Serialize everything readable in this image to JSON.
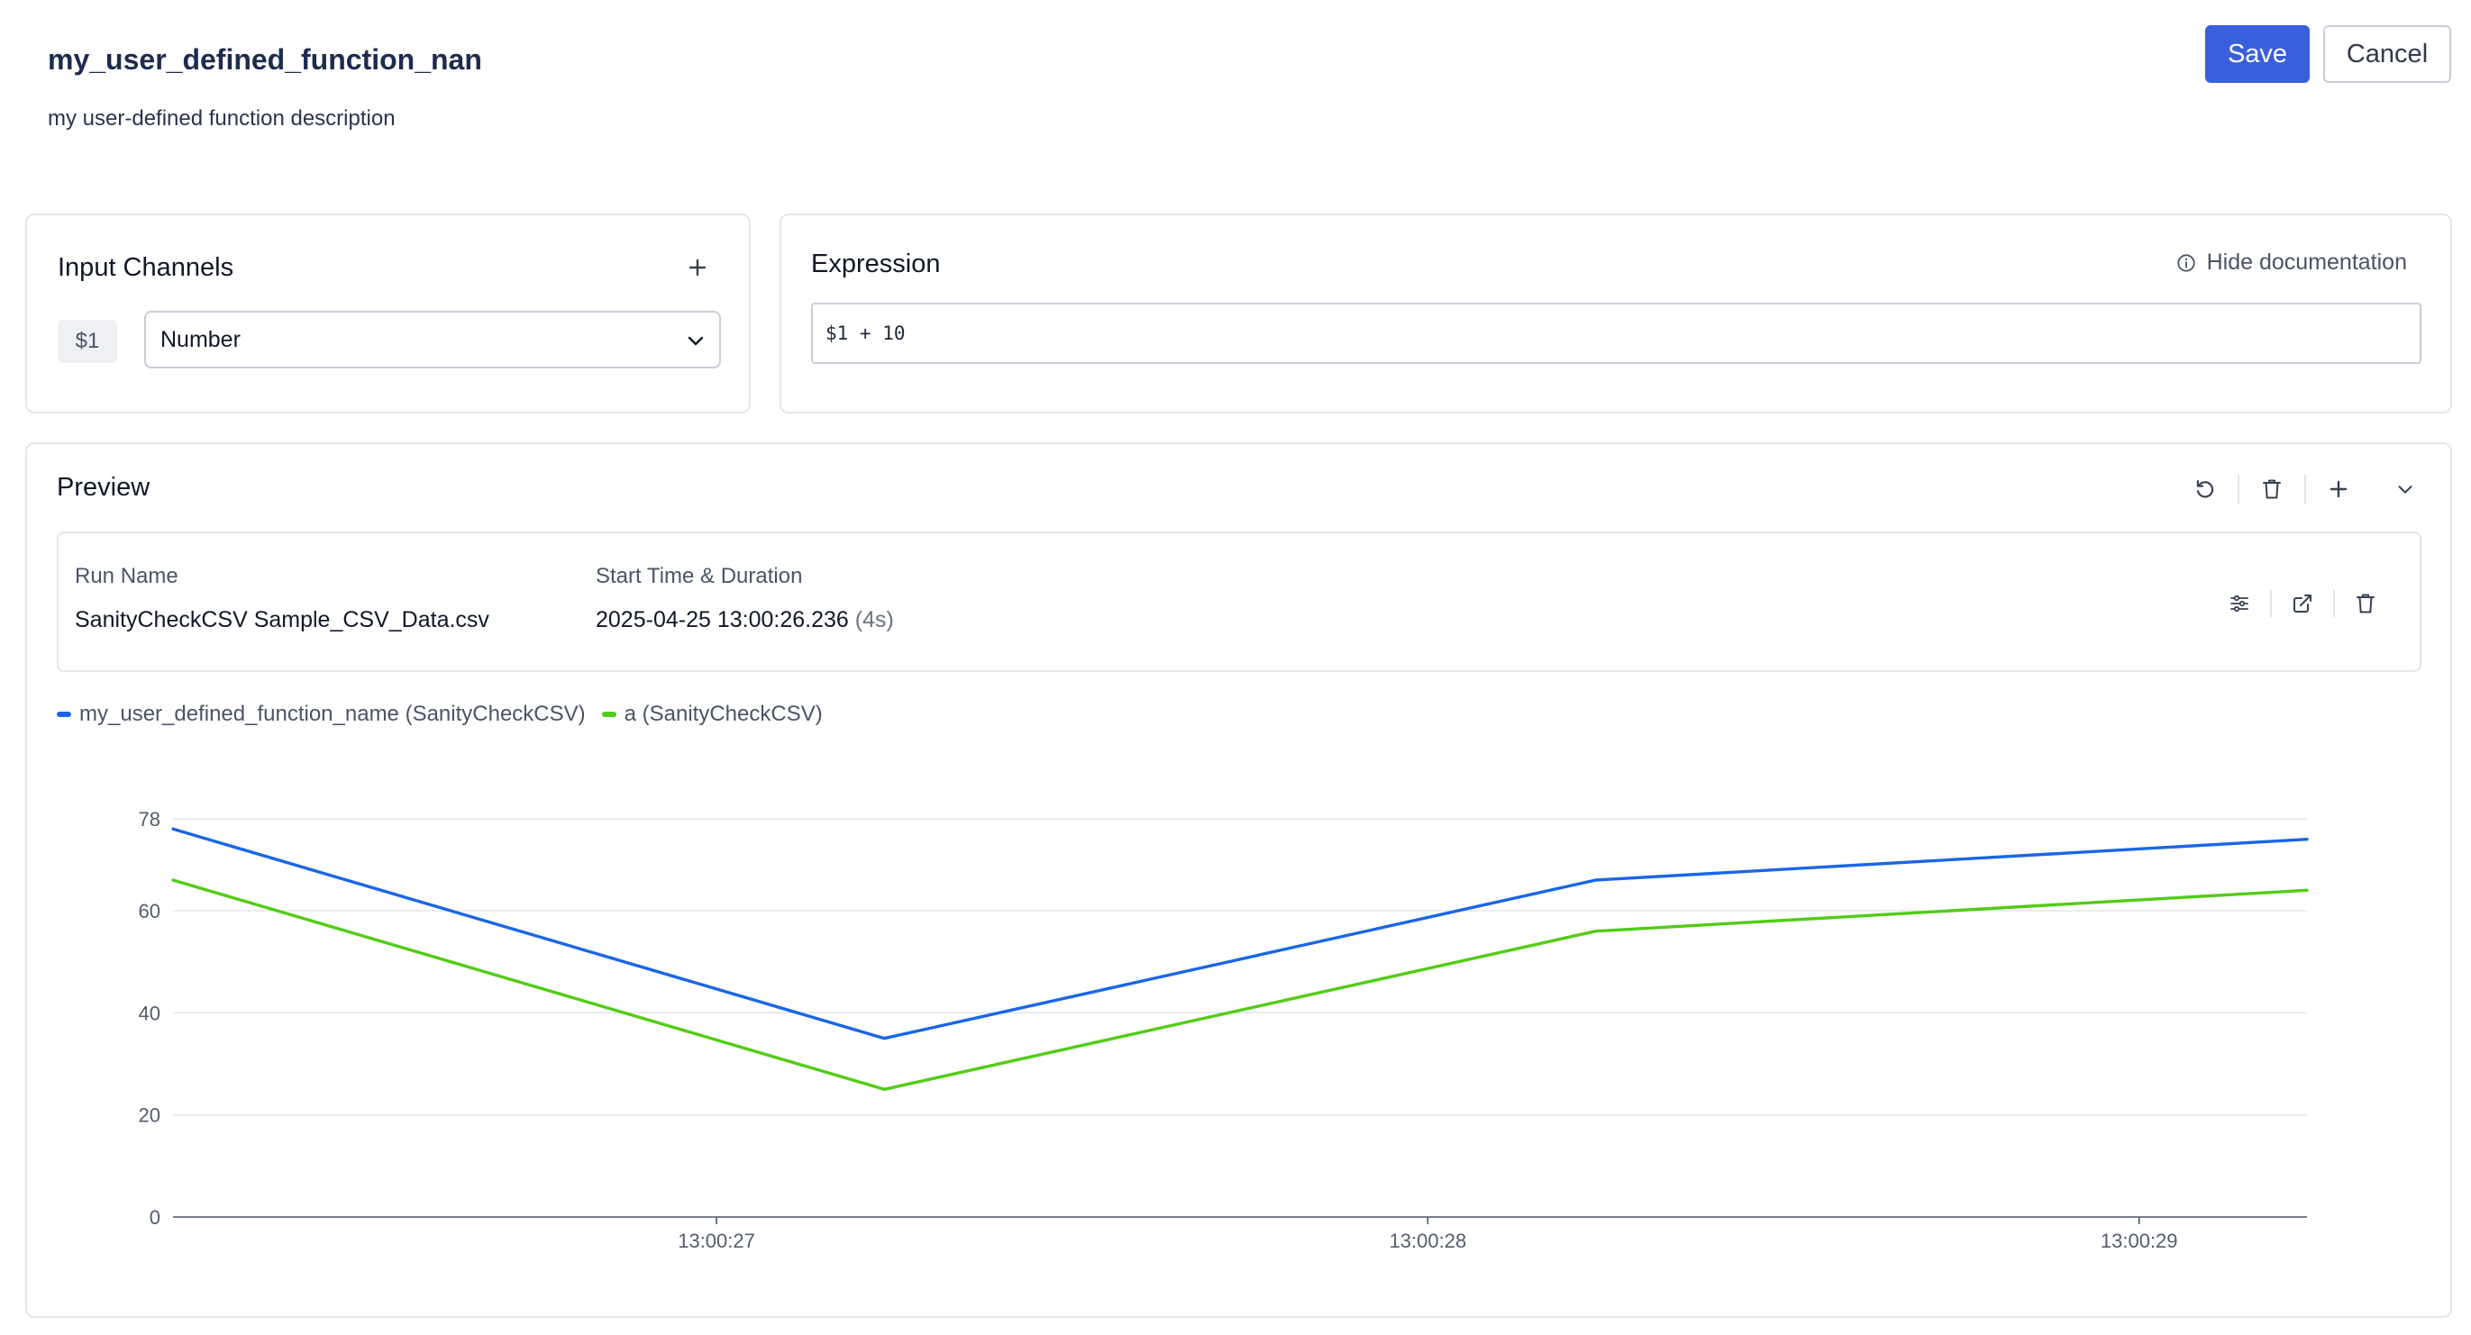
{
  "header": {
    "title": "my_user_defined_function_nan",
    "description": "my user-defined function description",
    "save_label": "Save",
    "cancel_label": "Cancel"
  },
  "input_channels": {
    "title": "Input Channels",
    "add_icon": "plus-icon",
    "channels": [
      {
        "variable": "$1",
        "type": "Number"
      }
    ]
  },
  "expression": {
    "title": "Expression",
    "hide_documentation_label": "Hide documentation",
    "value": "$1 + 10"
  },
  "preview": {
    "title": "Preview",
    "toolbar_icons": [
      "reset-icon",
      "trash-icon",
      "plus-icon",
      "chevron-down-icon"
    ],
    "run": {
      "name_header": "Run Name",
      "time_header": "Start Time & Duration",
      "name": "SanityCheckCSV Sample_CSV_Data.csv",
      "start_time": "2025-04-25 13:00:26.236",
      "duration": "(4s)",
      "tool_icons": [
        "sliders-icon",
        "external-link-icon",
        "trash-icon"
      ]
    },
    "legend": [
      {
        "label": "my_user_defined_function_name (SanityCheckCSV)",
        "color": "#1a66e6"
      },
      {
        "label": "a (SanityCheckCSV)",
        "color": "#52cc16"
      }
    ]
  },
  "colors": {
    "accent": "#3a5fdc",
    "series_1": "#1a66e6",
    "series_2": "#52cc16",
    "grid": "#dfe2e8"
  },
  "chart_data": {
    "type": "line",
    "x": [
      "13:00:26.236",
      "13:00:27.236",
      "13:00:28.236",
      "13:00:29.236"
    ],
    "x_range_seconds": [
      26.236,
      29.236
    ],
    "x_ticks": [
      "13:00:27",
      "13:00:28",
      "13:00:29"
    ],
    "x_tick_values_seconds": [
      27,
      28,
      29
    ],
    "y_ticks": [
      0,
      20,
      40,
      60,
      78
    ],
    "ylim": [
      0,
      78
    ],
    "grid": true,
    "legend_position": "top-left",
    "series": [
      {
        "name": "my_user_defined_function_name (SanityCheckCSV)",
        "color": "#1a66e6",
        "x_seconds": [
          26.236,
          27.236,
          28.236,
          29.236
        ],
        "values": [
          76,
          35,
          66,
          74
        ]
      },
      {
        "name": "a (SanityCheckCSV)",
        "color": "#52cc16",
        "x_seconds": [
          26.236,
          27.236,
          28.236,
          29.236
        ],
        "values": [
          66,
          25,
          56,
          64
        ]
      }
    ]
  }
}
